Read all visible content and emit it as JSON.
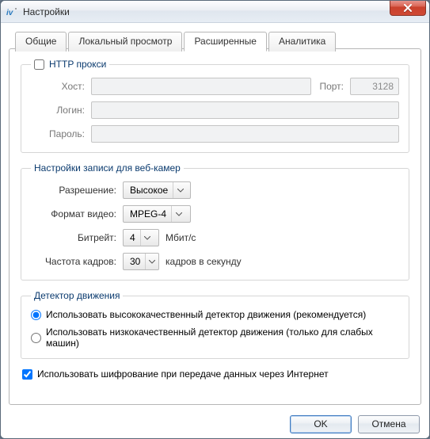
{
  "window": {
    "title": "Настройки"
  },
  "tabs": [
    {
      "label": "Общие",
      "active": false
    },
    {
      "label": "Локальный просмотр",
      "active": false
    },
    {
      "label": "Расширенные",
      "active": true
    },
    {
      "label": "Аналитика",
      "active": false
    }
  ],
  "proxy": {
    "legend": "HTTP прокси",
    "enabled": false,
    "host_label": "Хост:",
    "host": "",
    "port_label": "Порт:",
    "port": "3128",
    "login_label": "Логин:",
    "login": "",
    "password_label": "Пароль:",
    "password": ""
  },
  "webcam": {
    "legend": "Настройки записи для веб-камер",
    "resolution_label": "Разрешение:",
    "resolution_value": "Высокое",
    "format_label": "Формат видео:",
    "format_value": "MPEG-4",
    "bitrate_label": "Битрейт:",
    "bitrate_value": "4",
    "bitrate_unit": "Мбит/с",
    "fps_label": "Частота кадров:",
    "fps_value": "30",
    "fps_unit": "кадров в секунду"
  },
  "motion": {
    "legend": "Детектор движения",
    "opt_hq": "Использовать высококачественный детектор движения (рекомендуется)",
    "opt_lq": "Использовать низкокачественный детектор движения (только для слабых машин)",
    "selected": "hq"
  },
  "encrypt": {
    "label": "Использовать шифрование при передаче данных через Интернет",
    "checked": true
  },
  "buttons": {
    "ok": "OK",
    "cancel": "Отмена"
  }
}
